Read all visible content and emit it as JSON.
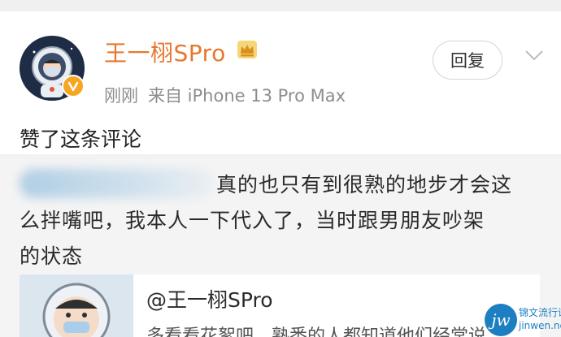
{
  "comment": {
    "username": "王一栩SPro",
    "timestamp": "刚刚",
    "source": "来自 iPhone 13 Pro Max",
    "reply_label": "回复",
    "action": "赞了这条评论"
  },
  "quoted_comment": {
    "line1": "真的也只有到很熟的地步才会这",
    "line2": "么拌嘴吧，我本人一下代入了，当时跟男朋友吵架",
    "line3": "的状态",
    "embed_title": "@王一栩SPro",
    "embed_preview": "多看看花絮吧，熟悉的人都知道他们经常说"
  },
  "watermark": {
    "logo": "jw",
    "line1": "锦文流行语",
    "line2": "jinwen.net"
  },
  "colors": {
    "username": "#e8772e",
    "meta": "#8d8d8d",
    "verified_badge": "#f6a623",
    "watermark": "#1d7fc1"
  }
}
